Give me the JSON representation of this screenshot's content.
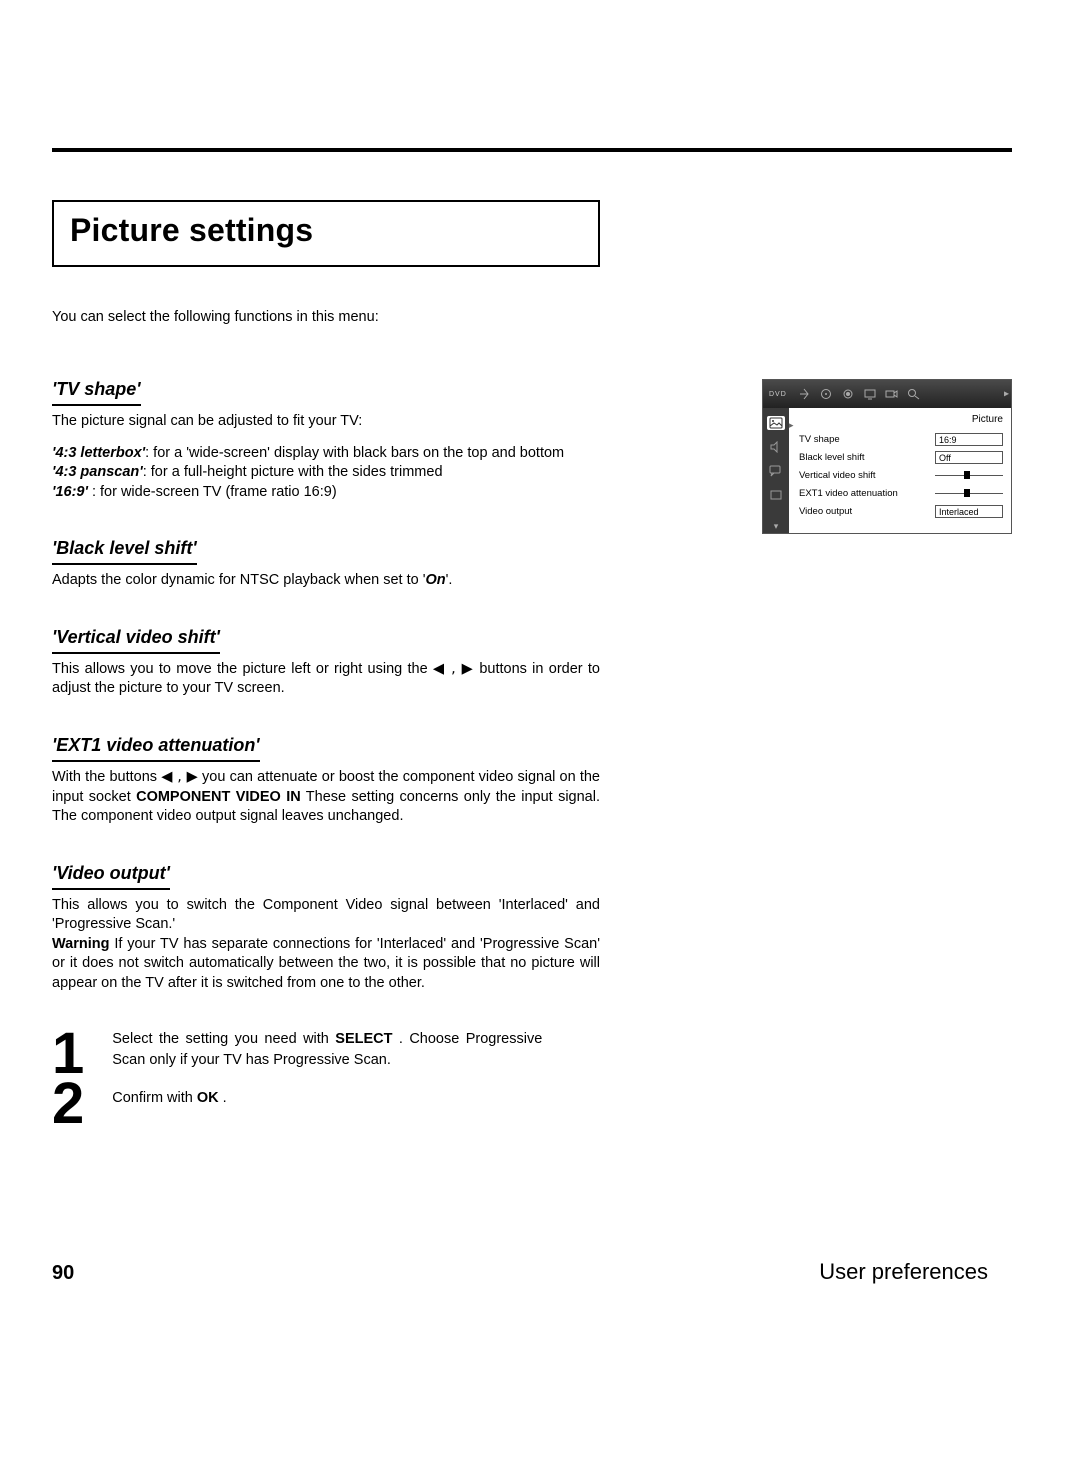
{
  "page": {
    "title": "Picture settings",
    "intro": "You can select the following functions in this menu:",
    "number": "90",
    "footer_title": "User preferences"
  },
  "sections": {
    "tvshape": {
      "heading": "'TV shape'",
      "intro": "The picture signal can be adjusted to fit your TV:",
      "opts": {
        "a_name": "'4:3 letterbox'",
        "a_desc": ": for a 'wide-screen' display with black bars on the top and bottom",
        "b_name": "'4:3 panscan'",
        "b_desc": ": for a full-height picture with the sides trimmed",
        "c_name": "'16:9'",
        "c_desc": " : for wide-screen TV (frame ratio 16:9)"
      }
    },
    "blacklevel": {
      "heading": "'Black level shift'",
      "text_pre": "Adapts the color dynamic for NTSC playback when set to '",
      "on": "On",
      "text_post": "'."
    },
    "vshift": {
      "heading": "'Vertical video shift'",
      "text_pre": "This allows you to move the picture left or right using the ",
      "arrows": "◀ , ▶",
      "text_post": " buttons in order to adjust the picture to your TV screen."
    },
    "ext1": {
      "heading": "'EXT1 video attenuation'",
      "text_a": "With the buttons ",
      "arrows": "◀ , ▶",
      "text_b": " you can attenuate or boost the component video signal on the input socket ",
      "bold": "COMPONENT VIDEO IN",
      "text_c": " These setting concerns only the input signal. The component video output signal leaves unchanged."
    },
    "vout": {
      "heading": "'Video output'",
      "p1": "This allows you to switch the Component Video signal between 'Interlaced' and 'Progressive Scan.'",
      "warn_label": "Warning",
      "p2": " If your TV has separate connections for 'Interlaced' and 'Progressive Scan' or it does not switch automatically between the two, it is possible that no picture will appear on the TV after it is switched from one to the other."
    },
    "steps": {
      "n1": "1",
      "n2": "2",
      "s1_a": "Select the setting you need with ",
      "s1_sel": "SELECT",
      "s1_b": " . Choose Progressive Scan only if your TV has Progressive Scan.",
      "s2_a": "Confirm with ",
      "s2_ok": "OK",
      "s2_b": " ."
    }
  },
  "osd": {
    "brand": "DVD",
    "panel_title": "Picture",
    "rows": {
      "tvshape": {
        "label": "TV shape",
        "value": "16:9"
      },
      "black": {
        "label": "Black level shift",
        "value": "Off"
      },
      "vshift": {
        "label": "Vertical video shift"
      },
      "ext1": {
        "label": "EXT1 video attenuation"
      },
      "vout": {
        "label": "Video output",
        "value": "Interlaced"
      }
    }
  }
}
